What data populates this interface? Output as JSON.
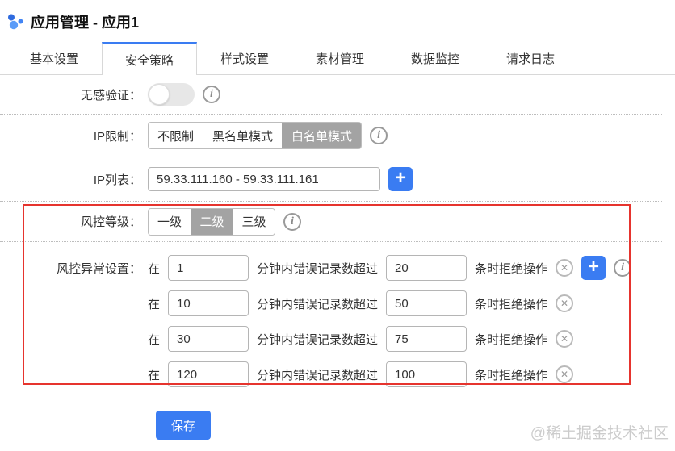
{
  "header": {
    "title": "应用管理 - 应用1"
  },
  "tabs": [
    {
      "label": "基本设置",
      "active": false
    },
    {
      "label": "安全策略",
      "active": true
    },
    {
      "label": "样式设置",
      "active": false
    },
    {
      "label": "素材管理",
      "active": false
    },
    {
      "label": "数据监控",
      "active": false
    },
    {
      "label": "请求日志",
      "active": false
    }
  ],
  "form": {
    "captcha": {
      "label": "无感验证：",
      "toggle_state": "off"
    },
    "ip_restrict": {
      "label": "IP限制：",
      "options": {
        "0": "不限制",
        "1": "黑名单模式",
        "2": "白名单模式"
      },
      "selected": "白名单模式"
    },
    "ip_list": {
      "label": "IP列表：",
      "value": "59.33.111.160 - 59.33.111.161"
    },
    "risk_level": {
      "label": "风控等级：",
      "options": {
        "0": "一级",
        "1": "二级",
        "2": "三级"
      },
      "selected": "二级"
    },
    "risk_rules": {
      "label": "风控异常设置：",
      "prefix": "在",
      "middle": "分钟内错误记录数超过",
      "suffix": "条时拒绝操作",
      "rows": [
        {
          "minutes": "1",
          "count": "20"
        },
        {
          "minutes": "10",
          "count": "50"
        },
        {
          "minutes": "30",
          "count": "75"
        },
        {
          "minutes": "120",
          "count": "100"
        }
      ]
    }
  },
  "icons": {
    "plus": "+",
    "close": "✕",
    "info": "i"
  },
  "save_button": "保存",
  "watermark": "@稀土掘金技术社区",
  "colors": {
    "accent_blue": "#3a7cf2",
    "selected_gray": "#a3a3a3",
    "annotation_red": "#e6342e"
  }
}
